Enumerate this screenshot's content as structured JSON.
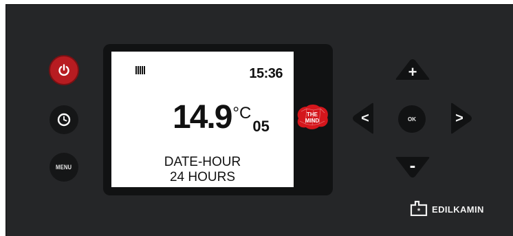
{
  "controls": {
    "power": {
      "icon": "power-icon"
    },
    "clock": {
      "icon": "clock-icon"
    },
    "menu": {
      "label": "MENU"
    }
  },
  "display": {
    "status_icon": "heater-icon",
    "time": "15:36",
    "temperature": "14.9",
    "temperature_unit": "°C",
    "temperature_suffix": "05",
    "line1": "DATE-HOUR",
    "line2": "24 HOURS"
  },
  "logo": {
    "line1": "THE",
    "line2": "MIND",
    "color": "#d4161c"
  },
  "nav": {
    "up_label": "+",
    "down_label": "-",
    "left_label": "<",
    "right_label": ">",
    "ok_label": "OK"
  },
  "brand": {
    "name": "EDILKAMIN"
  },
  "colors": {
    "panel": "#252628",
    "power": "#b71c21",
    "screen": "#ffffff"
  }
}
